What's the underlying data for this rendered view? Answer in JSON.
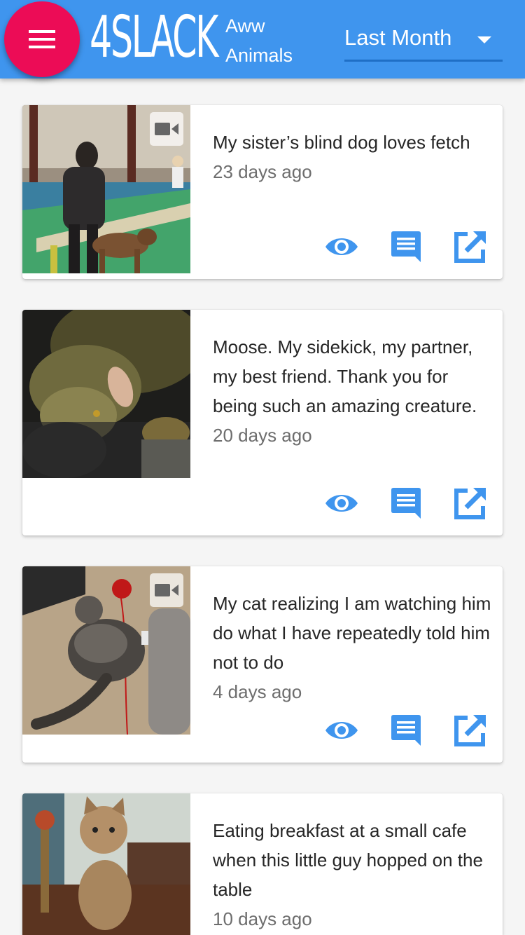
{
  "app": {
    "logo": "4SLACK",
    "subreddit_line1": "Aww",
    "subreddit_line2": "Animals",
    "period_selected": "Last Month",
    "accent_color": "#3f95ee",
    "menu_button_color": "#ec0c56"
  },
  "icons": {
    "menu": "hamburger-menu-icon",
    "dropdown": "caret-down-icon",
    "video": "video-camera-icon",
    "view": "eye-icon",
    "comments": "comment-icon",
    "open": "open-external-icon"
  },
  "posts": [
    {
      "title": "My sister’s blind dog loves fetch",
      "age": "23 days ago",
      "is_video": true,
      "image": "woman walking brindle dog in indoor agility arena"
    },
    {
      "title": "Moose. My sidekick, my partner, my best friend. Thank you for being such an amazing creature.",
      "age": "20 days ago",
      "is_video": false,
      "image": "large dog resting head on leather couch with owner's hand"
    },
    {
      "title": "My cat realizing I am watching him do what I have repeatedly told him not to do",
      "age": "4 days ago",
      "is_video": true,
      "image": "tabby cat lying on carpet playing with red yarn"
    },
    {
      "title": "Eating breakfast at a small cafe when this little guy hopped on the table",
      "age": "10 days ago",
      "is_video": false,
      "image": "fluffy kitten sitting on wooden table"
    }
  ]
}
